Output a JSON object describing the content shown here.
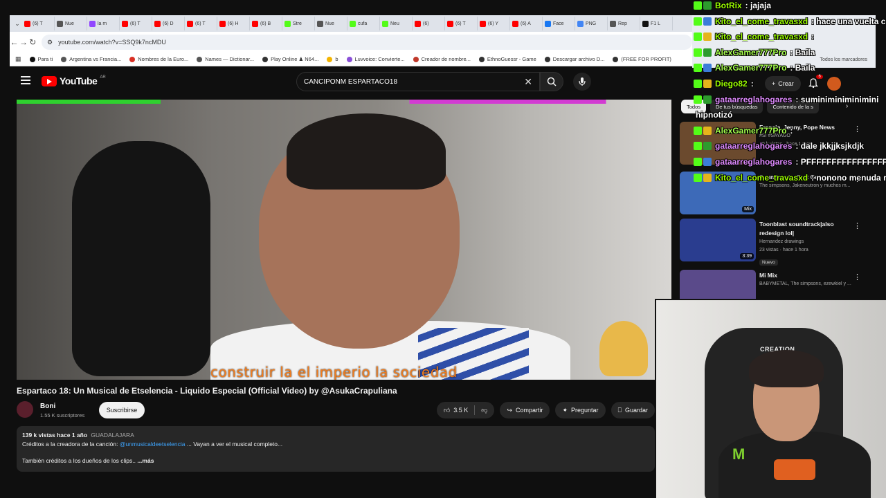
{
  "browser": {
    "tabs": [
      {
        "label": "(6) T",
        "color": "#ff0000"
      },
      {
        "label": "Nue",
        "color": "#555555"
      },
      {
        "label": "la m",
        "color": "#9146ff"
      },
      {
        "label": "(6) T",
        "color": "#ff0000"
      },
      {
        "label": "(6) D",
        "color": "#ff0000"
      },
      {
        "label": "(6) T",
        "color": "#ff0000"
      },
      {
        "label": "(6) H",
        "color": "#ff0000"
      },
      {
        "label": "(6) B",
        "color": "#ff0000"
      },
      {
        "label": "Stre",
        "color": "#53fc18"
      },
      {
        "label": "Nue",
        "color": "#555555"
      },
      {
        "label": "cufa",
        "color": "#53fc18"
      },
      {
        "label": "Neu",
        "color": "#53fc18"
      },
      {
        "label": "(6)",
        "color": "#ff0000"
      },
      {
        "label": "(6) T",
        "color": "#ff0000"
      },
      {
        "label": "(6) Y",
        "color": "#ff0000"
      },
      {
        "label": "(6) A",
        "color": "#ff0000"
      },
      {
        "label": "Face",
        "color": "#1877f2"
      },
      {
        "label": "PNG",
        "color": "#4285f4"
      },
      {
        "label": "Rep",
        "color": "#555555"
      },
      {
        "label": "F1 L",
        "color": "#111111"
      }
    ],
    "url": "youtube.com/watch?v=SSQ9k7ncMDU",
    "bookmarks": [
      {
        "label": "Para ti",
        "color": "#111111"
      },
      {
        "label": "Argentina vs Francia...",
        "color": "#555555"
      },
      {
        "label": "Nombres de la Euro...",
        "color": "#d93025"
      },
      {
        "label": "Names — Dictionar...",
        "color": "#555555"
      },
      {
        "label": "Play Online ♟ N64...",
        "color": "#333333"
      },
      {
        "label": "b",
        "color": "#f4b400"
      },
      {
        "label": "Luvvoice: Convierte...",
        "color": "#8a4fd8"
      },
      {
        "label": "Creador de nombre...",
        "color": "#c0392b"
      },
      {
        "label": "EthnoGuessr - Game",
        "color": "#333333"
      },
      {
        "label": "Descargar archivo D...",
        "color": "#333333"
      },
      {
        "label": "(FREE FOR PROFIT)",
        "color": "#333333"
      }
    ],
    "all_bookmarks": "Todos los marcadores"
  },
  "youtube": {
    "logo": "YouTube",
    "country": "AR",
    "search_value": "CANCIPONM ESPARTACO18",
    "create_label": "Crear",
    "notification_count": "6",
    "chips": [
      "Todos",
      "De tus búsquedas",
      "Contenido de la s"
    ]
  },
  "video": {
    "subtitle": "construir la el imperio la sociedad",
    "title": "Espartaco 18: Un Musical de Etselencia - Liquido Especial (Official Video) by @AsukaCrapuliana",
    "channel_name": "Boni",
    "channel_subs": "1.55 K suscriptores",
    "subscribe_label": "Suscribirse",
    "likes": "3.5 K",
    "share_label": "Compartir",
    "ask_label": "Preguntar",
    "save_label": "Guardar",
    "views": "139 k vistas",
    "age": "hace 1 año",
    "location": "GUADALAJARA",
    "desc_line1_prefix": "Créditos a la creadora de la canción:",
    "desc_link": "@unmusicaldeetselencia",
    "desc_line1_suffix": "... Vayan a ver el musical completo...",
    "desc_line2": "También créditos a los dueños de los clips..",
    "more_label": "...más"
  },
  "recommendations": [
    {
      "title": "Francia, Jenny, Pope News",
      "sub1": "#SI #SAYAGO",
      "sub2": "10 k vistas · hace 1 mes",
      "duration": "",
      "thumb": "#6b4a2e"
    },
    {
      "title": "Soundtrack - Bart Goes ...",
      "sub1": "The simpsons, Jakeneutron y muchos m...",
      "sub2": "",
      "duration": "Mix",
      "thumb": "#3d6ab8"
    },
    {
      "title": "Toonblast soundtrack|also redesign lol|",
      "sub1": "Hernandez drawings",
      "sub2": "23 vistas · hace 1 hora",
      "duration": "3:39",
      "badge": "Nuevo",
      "thumb": "#2a3d8f"
    },
    {
      "title": "Mi Mix",
      "sub1": "BABYMETAL, The simpsons, ezewkiel y ...",
      "sub2": "",
      "duration": "",
      "thumb": "#5a4a8a"
    }
  ],
  "chat": [
    {
      "user": "BotRix",
      "text": ": jajaja",
      "color": "#9cff00"
    },
    {
      "user": "Kito_el_come_travasxd",
      "text": ": hace una vuelta c",
      "color": "#9cff00"
    },
    {
      "user": "Kito_el_come_travasxd",
      "text": ":",
      "color": "#9cff00"
    },
    {
      "user": "AlexGamer777Pro",
      "text": ": Baila",
      "color": "#a6ff4d"
    },
    {
      "user": "AlexGamer777Pro",
      "text": ": Baila",
      "color": "#a6ff4d"
    },
    {
      "user": "Diego82",
      "text": ":",
      "color": "#9cff00"
    },
    {
      "user": "gataarreglahogares",
      "text": ": suminiminiminimini",
      "color": "#e08bff"
    },
    {
      "user": "",
      "text": "hipnotizó",
      "color": "#ffffff"
    },
    {
      "user": "AlexGamer777Pro",
      "text": ":",
      "color": "#a6ff4d"
    },
    {
      "user": "gataarreglahogares",
      "text": ": dale jkkjjksjkdjk",
      "color": "#e08bff"
    },
    {
      "user": "gataarreglahogares",
      "text": ": PFFFFFFFFFFFFFFFF",
      "color": "#e08bff"
    },
    {
      "user": "Kito_el_come_travasxd",
      "text": ": nonono menuda n",
      "color": "#9cff00"
    }
  ],
  "webcam": {
    "chair_brand": "CREATION",
    "shirt_logo": "M"
  }
}
